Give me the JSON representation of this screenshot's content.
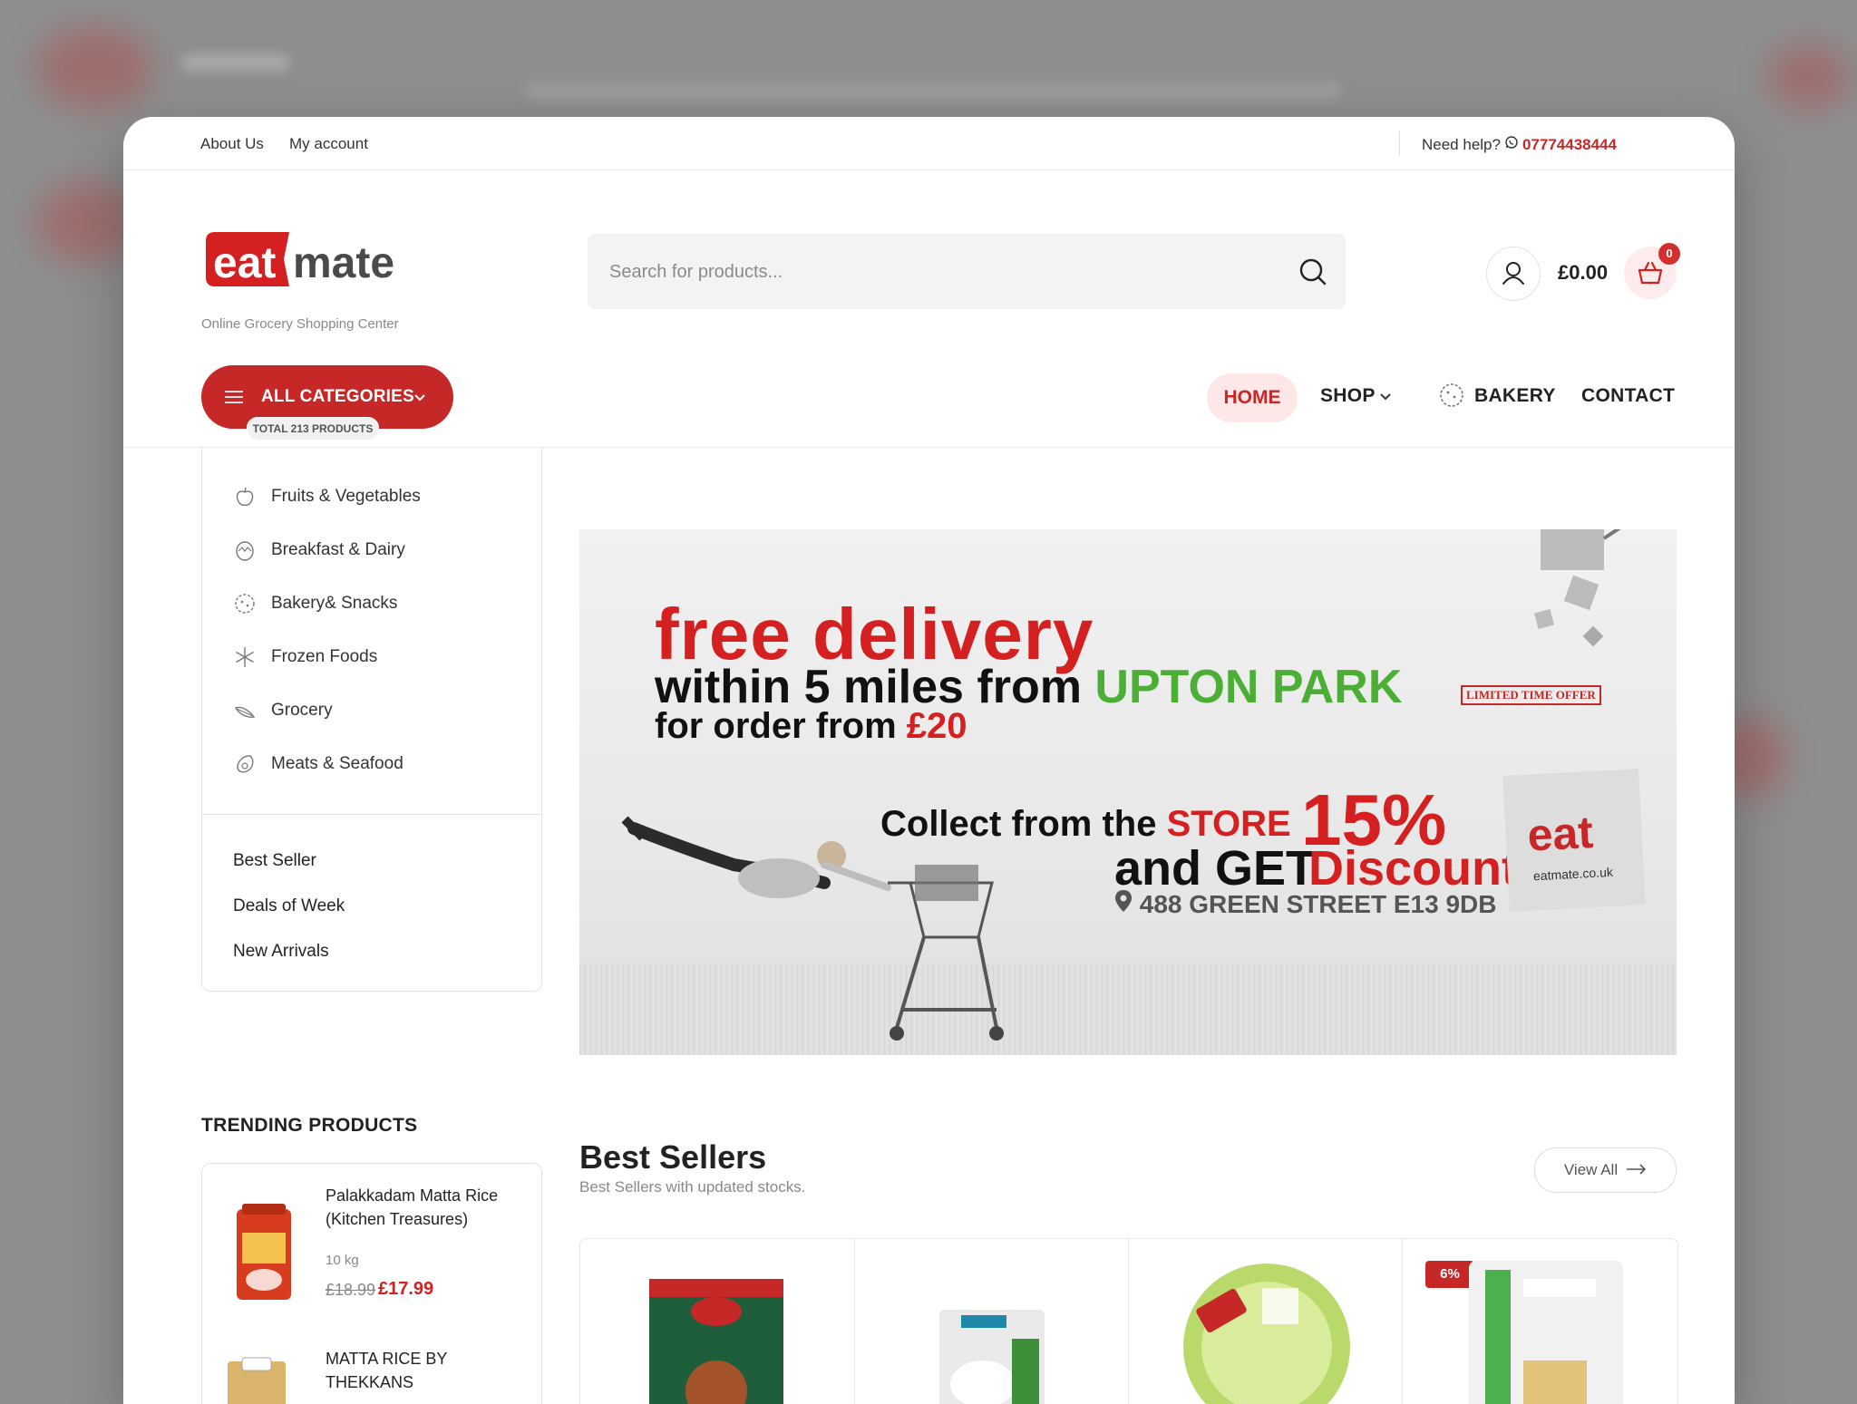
{
  "topbar": {
    "about": "About Us",
    "account": "My account",
    "help": "Need help?",
    "phone": "07774438444"
  },
  "brand": {
    "logo_left": "eat",
    "logo_right": "mate",
    "tagline": "Online Grocery Shopping Center"
  },
  "search": {
    "placeholder": "Search for products..."
  },
  "header": {
    "price": "£0.00",
    "cart_count": "0"
  },
  "categories_button": {
    "label": "ALL CATEGORIES",
    "total": "TOTAL 213 PRODUCTS"
  },
  "nav": {
    "home": "HOME",
    "shop": "SHOP",
    "bakery": "BAKERY",
    "contact": "CONTACT"
  },
  "sidebar": {
    "categories": [
      {
        "label": "Fruits & Vegetables",
        "icon": "apple-icon"
      },
      {
        "label": "Breakfast & Dairy",
        "icon": "egg-icon"
      },
      {
        "label": "Bakery& Snacks",
        "icon": "cookie-icon"
      },
      {
        "label": "Frozen Foods",
        "icon": "snowflake-icon"
      },
      {
        "label": "Grocery",
        "icon": "leaf-icon"
      },
      {
        "label": "Meats & Seafood",
        "icon": "meat-icon"
      }
    ],
    "links": [
      "Best Seller",
      "Deals of Week",
      "New Arrivals"
    ]
  },
  "banner": {
    "line1": "free delivery",
    "line2_a": "within 5 miles from ",
    "line2_b": "UPTON PARK",
    "limited": "LIMITED TIME OFFER",
    "line3_a": "for order from ",
    "line3_b": "£20",
    "collect_a": "Collect from the ",
    "collect_b": "STORE",
    "percent": "15%",
    "and_get": "and GET",
    "discount": "Discount",
    "address": "488 GREEN STREET E13 9DB",
    "stamp_logo": "eat",
    "stamp_url": "eatmate.co.uk"
  },
  "trending": {
    "title": "TRENDING PRODUCTS",
    "products": [
      {
        "name": "Palakkadam Matta Rice (Kitchen Treasures)",
        "weight": "10 kg",
        "old_price": "£18.99",
        "new_price": "£17.99"
      },
      {
        "name": "MATTA RICE BY THEKKANS"
      }
    ]
  },
  "best_sellers": {
    "title": "Best Sellers",
    "subtitle": "Best Sellers with updated stocks.",
    "view_all": "View All",
    "discount_badge": "6%"
  },
  "colors": {
    "accent": "#c62828",
    "green": "#4caf35"
  }
}
